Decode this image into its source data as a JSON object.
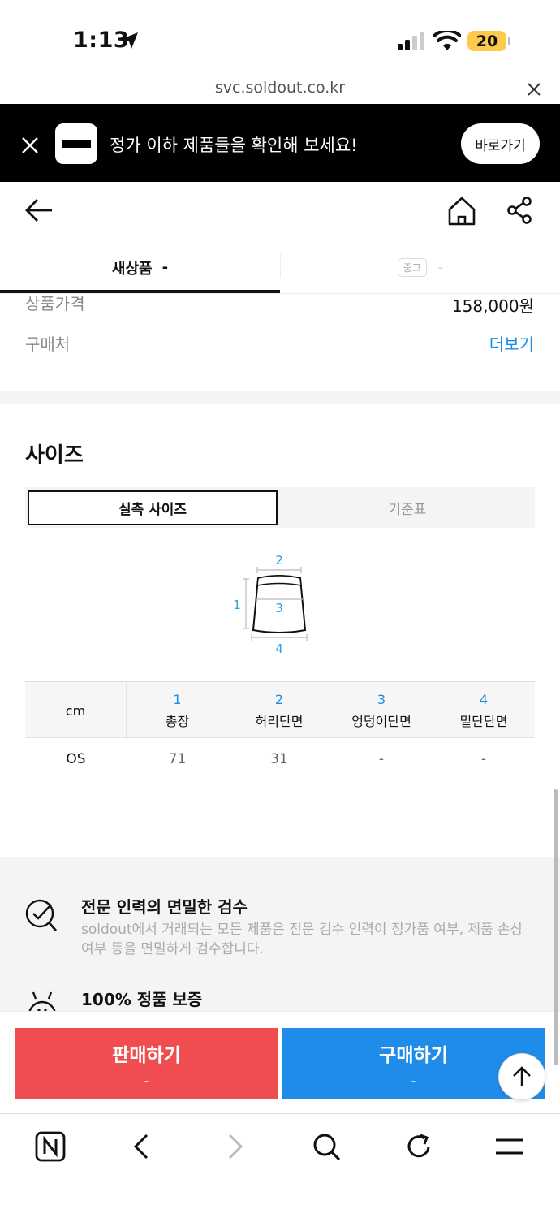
{
  "status_bar": {
    "time": "1:13",
    "battery": "20",
    "battery_color": "#ffc94a"
  },
  "url_bar": {
    "url": "svc.soldout.co.kr"
  },
  "banner": {
    "text": "정가 이하 제품들을 확인해 보세요!",
    "button": "바로가기"
  },
  "tabs": {
    "new": {
      "label": "새상품",
      "value": "-"
    },
    "used": {
      "badge": "중고",
      "value": "-"
    }
  },
  "product_info": {
    "price_label": "상품가격",
    "price_value": "158,000원",
    "store_label": "구매처",
    "store_link": "더보기"
  },
  "size": {
    "title": "사이즈",
    "tab_active": "실측 사이즈",
    "tab_inactive": "기준표",
    "diagram_labels": [
      "1",
      "2",
      "3",
      "4"
    ],
    "table": {
      "unit": "cm",
      "columns": [
        {
          "num": "1",
          "name": "총장"
        },
        {
          "num": "2",
          "name": "허리단면"
        },
        {
          "num": "3",
          "name": "엉덩이단면"
        },
        {
          "num": "4",
          "name": "밑단단면"
        }
      ],
      "rows": [
        {
          "size": "OS",
          "values": [
            "71",
            "31",
            "-",
            "-"
          ]
        }
      ]
    }
  },
  "info": {
    "inspection_title": "전문 인력의 면밀한 검수",
    "inspection_desc": "soldout에서 거래되는 모든 제품은 전문 검수 인력이 정가품 여부, 제품 손상 여부 등을 면밀하게 검수합니다.",
    "guarantee_title": "100% 정품 보증"
  },
  "actions": {
    "sell_label": "판매하기",
    "sell_sub": "-",
    "sell_color": "#ef4d4f",
    "buy_label": "구매하기",
    "buy_sub": "-",
    "buy_color": "#1f8cea"
  },
  "accent_color": "#1a8de0",
  "toolbar_icons": [
    "naver-icon",
    "back-icon",
    "forward-icon",
    "search-icon",
    "refresh-icon",
    "menu-icon"
  ]
}
